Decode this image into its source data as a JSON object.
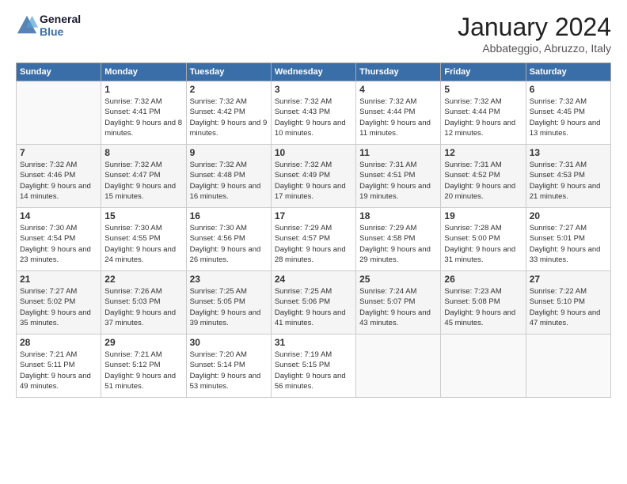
{
  "header": {
    "logo_line1": "General",
    "logo_line2": "Blue",
    "month": "January 2024",
    "location": "Abbateggio, Abruzzo, Italy"
  },
  "weekdays": [
    "Sunday",
    "Monday",
    "Tuesday",
    "Wednesday",
    "Thursday",
    "Friday",
    "Saturday"
  ],
  "weeks": [
    [
      {
        "day": "",
        "sunrise": "",
        "sunset": "",
        "daylight": ""
      },
      {
        "day": "1",
        "sunrise": "Sunrise: 7:32 AM",
        "sunset": "Sunset: 4:41 PM",
        "daylight": "Daylight: 9 hours and 8 minutes."
      },
      {
        "day": "2",
        "sunrise": "Sunrise: 7:32 AM",
        "sunset": "Sunset: 4:42 PM",
        "daylight": "Daylight: 9 hours and 9 minutes."
      },
      {
        "day": "3",
        "sunrise": "Sunrise: 7:32 AM",
        "sunset": "Sunset: 4:43 PM",
        "daylight": "Daylight: 9 hours and 10 minutes."
      },
      {
        "day": "4",
        "sunrise": "Sunrise: 7:32 AM",
        "sunset": "Sunset: 4:44 PM",
        "daylight": "Daylight: 9 hours and 11 minutes."
      },
      {
        "day": "5",
        "sunrise": "Sunrise: 7:32 AM",
        "sunset": "Sunset: 4:44 PM",
        "daylight": "Daylight: 9 hours and 12 minutes."
      },
      {
        "day": "6",
        "sunrise": "Sunrise: 7:32 AM",
        "sunset": "Sunset: 4:45 PM",
        "daylight": "Daylight: 9 hours and 13 minutes."
      }
    ],
    [
      {
        "day": "7",
        "sunrise": "Sunrise: 7:32 AM",
        "sunset": "Sunset: 4:46 PM",
        "daylight": "Daylight: 9 hours and 14 minutes."
      },
      {
        "day": "8",
        "sunrise": "Sunrise: 7:32 AM",
        "sunset": "Sunset: 4:47 PM",
        "daylight": "Daylight: 9 hours and 15 minutes."
      },
      {
        "day": "9",
        "sunrise": "Sunrise: 7:32 AM",
        "sunset": "Sunset: 4:48 PM",
        "daylight": "Daylight: 9 hours and 16 minutes."
      },
      {
        "day": "10",
        "sunrise": "Sunrise: 7:32 AM",
        "sunset": "Sunset: 4:49 PM",
        "daylight": "Daylight: 9 hours and 17 minutes."
      },
      {
        "day": "11",
        "sunrise": "Sunrise: 7:31 AM",
        "sunset": "Sunset: 4:51 PM",
        "daylight": "Daylight: 9 hours and 19 minutes."
      },
      {
        "day": "12",
        "sunrise": "Sunrise: 7:31 AM",
        "sunset": "Sunset: 4:52 PM",
        "daylight": "Daylight: 9 hours and 20 minutes."
      },
      {
        "day": "13",
        "sunrise": "Sunrise: 7:31 AM",
        "sunset": "Sunset: 4:53 PM",
        "daylight": "Daylight: 9 hours and 21 minutes."
      }
    ],
    [
      {
        "day": "14",
        "sunrise": "Sunrise: 7:30 AM",
        "sunset": "Sunset: 4:54 PM",
        "daylight": "Daylight: 9 hours and 23 minutes."
      },
      {
        "day": "15",
        "sunrise": "Sunrise: 7:30 AM",
        "sunset": "Sunset: 4:55 PM",
        "daylight": "Daylight: 9 hours and 24 minutes."
      },
      {
        "day": "16",
        "sunrise": "Sunrise: 7:30 AM",
        "sunset": "Sunset: 4:56 PM",
        "daylight": "Daylight: 9 hours and 26 minutes."
      },
      {
        "day": "17",
        "sunrise": "Sunrise: 7:29 AM",
        "sunset": "Sunset: 4:57 PM",
        "daylight": "Daylight: 9 hours and 28 minutes."
      },
      {
        "day": "18",
        "sunrise": "Sunrise: 7:29 AM",
        "sunset": "Sunset: 4:58 PM",
        "daylight": "Daylight: 9 hours and 29 minutes."
      },
      {
        "day": "19",
        "sunrise": "Sunrise: 7:28 AM",
        "sunset": "Sunset: 5:00 PM",
        "daylight": "Daylight: 9 hours and 31 minutes."
      },
      {
        "day": "20",
        "sunrise": "Sunrise: 7:27 AM",
        "sunset": "Sunset: 5:01 PM",
        "daylight": "Daylight: 9 hours and 33 minutes."
      }
    ],
    [
      {
        "day": "21",
        "sunrise": "Sunrise: 7:27 AM",
        "sunset": "Sunset: 5:02 PM",
        "daylight": "Daylight: 9 hours and 35 minutes."
      },
      {
        "day": "22",
        "sunrise": "Sunrise: 7:26 AM",
        "sunset": "Sunset: 5:03 PM",
        "daylight": "Daylight: 9 hours and 37 minutes."
      },
      {
        "day": "23",
        "sunrise": "Sunrise: 7:25 AM",
        "sunset": "Sunset: 5:05 PM",
        "daylight": "Daylight: 9 hours and 39 minutes."
      },
      {
        "day": "24",
        "sunrise": "Sunrise: 7:25 AM",
        "sunset": "Sunset: 5:06 PM",
        "daylight": "Daylight: 9 hours and 41 minutes."
      },
      {
        "day": "25",
        "sunrise": "Sunrise: 7:24 AM",
        "sunset": "Sunset: 5:07 PM",
        "daylight": "Daylight: 9 hours and 43 minutes."
      },
      {
        "day": "26",
        "sunrise": "Sunrise: 7:23 AM",
        "sunset": "Sunset: 5:08 PM",
        "daylight": "Daylight: 9 hours and 45 minutes."
      },
      {
        "day": "27",
        "sunrise": "Sunrise: 7:22 AM",
        "sunset": "Sunset: 5:10 PM",
        "daylight": "Daylight: 9 hours and 47 minutes."
      }
    ],
    [
      {
        "day": "28",
        "sunrise": "Sunrise: 7:21 AM",
        "sunset": "Sunset: 5:11 PM",
        "daylight": "Daylight: 9 hours and 49 minutes."
      },
      {
        "day": "29",
        "sunrise": "Sunrise: 7:21 AM",
        "sunset": "Sunset: 5:12 PM",
        "daylight": "Daylight: 9 hours and 51 minutes."
      },
      {
        "day": "30",
        "sunrise": "Sunrise: 7:20 AM",
        "sunset": "Sunset: 5:14 PM",
        "daylight": "Daylight: 9 hours and 53 minutes."
      },
      {
        "day": "31",
        "sunrise": "Sunrise: 7:19 AM",
        "sunset": "Sunset: 5:15 PM",
        "daylight": "Daylight: 9 hours and 56 minutes."
      },
      {
        "day": "",
        "sunrise": "",
        "sunset": "",
        "daylight": ""
      },
      {
        "day": "",
        "sunrise": "",
        "sunset": "",
        "daylight": ""
      },
      {
        "day": "",
        "sunrise": "",
        "sunset": "",
        "daylight": ""
      }
    ]
  ]
}
